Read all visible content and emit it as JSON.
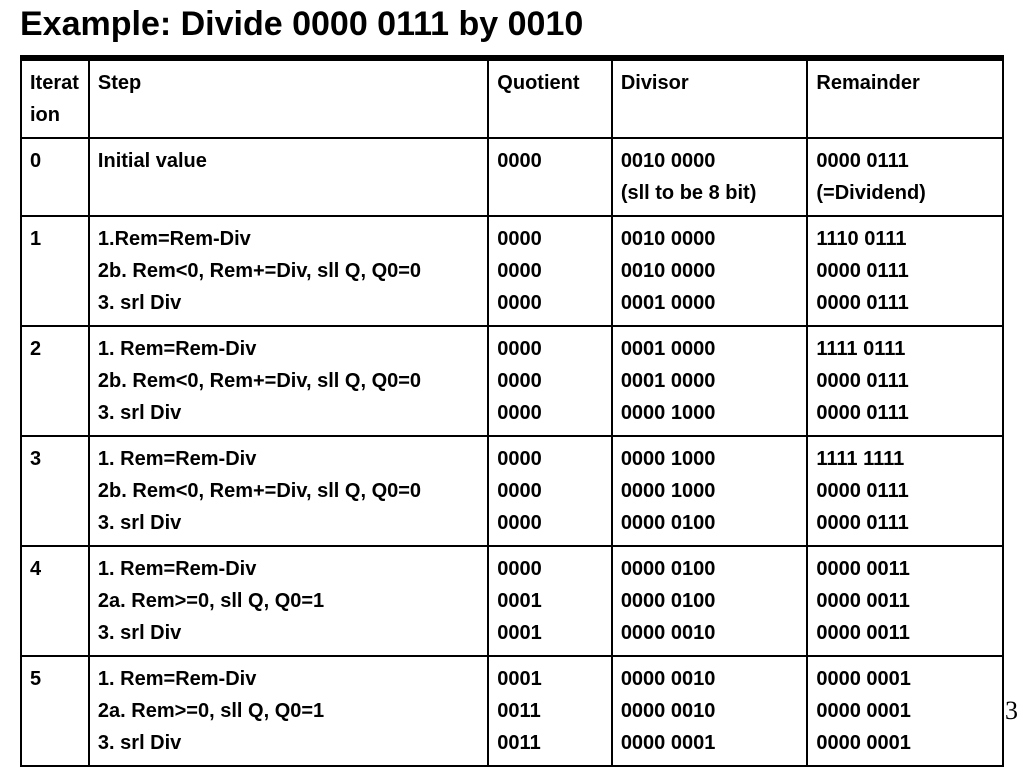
{
  "title": "Example: Divide 0000 0111 by 0010",
  "page_number": "3",
  "columns": {
    "iteration": "Iteration",
    "step": "Step",
    "quotient": "Quotient",
    "divisor": "Divisor",
    "remainder": "Remainder"
  },
  "rows": [
    {
      "iteration": "0",
      "steps": [
        "Initial value"
      ],
      "quotients": [
        "0000"
      ],
      "divisors": [
        "0010 0000",
        "(sll to be 8 bit)"
      ],
      "remainders": [
        "0000 0111",
        "(=Dividend)"
      ]
    },
    {
      "iteration": "1",
      "steps": [
        "1.Rem=Rem-Div",
        "2b. Rem<0, Rem+=Div, sll Q, Q0=0",
        "3. srl Div"
      ],
      "quotients": [
        "0000",
        "0000",
        "0000"
      ],
      "divisors": [
        "0010 0000",
        "0010 0000",
        "0001 0000"
      ],
      "remainders": [
        "1110 0111",
        "0000 0111",
        "0000 0111"
      ]
    },
    {
      "iteration": "2",
      "steps": [
        "1. Rem=Rem-Div",
        "2b. Rem<0, Rem+=Div, sll Q, Q0=0",
        "3. srl Div"
      ],
      "quotients": [
        "0000",
        "0000",
        "0000"
      ],
      "divisors": [
        "0001 0000",
        "0001 0000",
        "0000 1000"
      ],
      "remainders": [
        "1111 0111",
        "0000 0111",
        "0000 0111"
      ]
    },
    {
      "iteration": "3",
      "steps": [
        "1. Rem=Rem-Div",
        "2b. Rem<0, Rem+=Div, sll Q, Q0=0",
        "3. srl Div"
      ],
      "quotients": [
        "0000",
        "0000",
        "0000"
      ],
      "divisors": [
        "0000 1000",
        "0000 1000",
        "0000 0100"
      ],
      "remainders": [
        "1111 1111",
        "0000 0111",
        "0000 0111"
      ]
    },
    {
      "iteration": "4",
      "steps": [
        "1. Rem=Rem-Div",
        "2a. Rem>=0, sll Q, Q0=1",
        "3. srl Div"
      ],
      "quotients": [
        "0000",
        "0001",
        "0001"
      ],
      "divisors": [
        "0000 0100",
        "0000 0100",
        "0000 0010"
      ],
      "remainders": [
        "0000 0011",
        "0000 0011",
        "0000 0011"
      ]
    },
    {
      "iteration": "5",
      "steps": [
        "1. Rem=Rem-Div",
        "2a. Rem>=0, sll Q, Q0=1",
        "3. srl Div"
      ],
      "quotients": [
        "0001",
        "0011",
        "0011"
      ],
      "divisors": [
        "0000 0010",
        "0000 0010",
        "0000 0001"
      ],
      "remainders": [
        "0000 0001",
        "0000 0001",
        "0000 0001"
      ]
    }
  ]
}
